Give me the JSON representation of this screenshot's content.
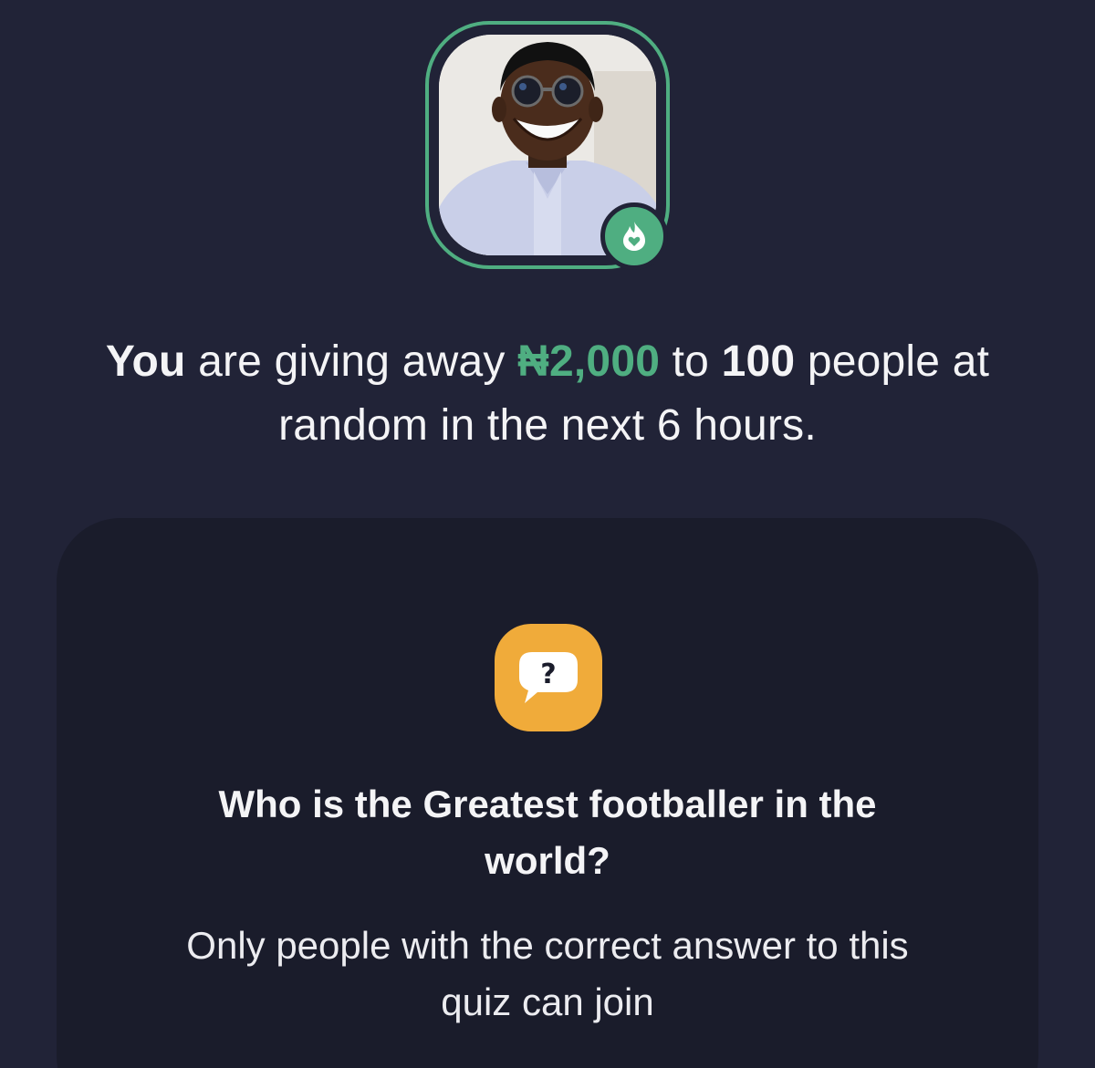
{
  "profile": {
    "avatar_alt": "profile photo",
    "ring_color": "#4fae81",
    "badge_icon": "flame-heart-icon"
  },
  "headline": {
    "subject": "You",
    "text_1": " are giving away ",
    "amount": "₦2,000",
    "text_2": " to ",
    "count": "100",
    "text_3": " people at random in the next 6 hours."
  },
  "quiz": {
    "icon": "question-bubble-icon",
    "question": "Who is the Greatest footballer in the world?",
    "note": "Only people with the correct answer to this quiz can join"
  },
  "colors": {
    "background": "#212337",
    "card": "#1a1c2b",
    "accent": "#4fae81",
    "quiz_icon_bg": "#f0ab3a"
  }
}
